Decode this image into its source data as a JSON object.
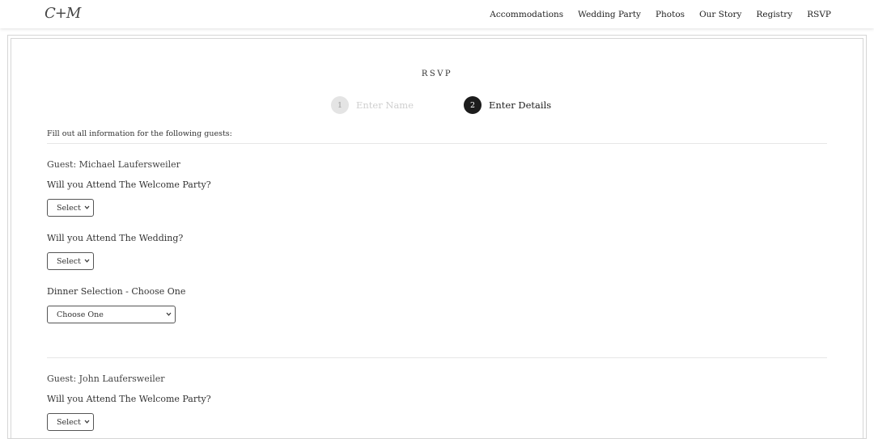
{
  "brand": {
    "logo": "C+M"
  },
  "nav": {
    "items": [
      {
        "label": "Accommodations"
      },
      {
        "label": "Wedding Party"
      },
      {
        "label": "Photos"
      },
      {
        "label": "Our Story"
      },
      {
        "label": "Registry"
      },
      {
        "label": "RSVP"
      }
    ]
  },
  "rsvp": {
    "title": "RSVP",
    "steps": [
      {
        "number": "1",
        "label": "Enter Name",
        "state": "inactive"
      },
      {
        "number": "2",
        "label": "Enter Details",
        "state": "active"
      }
    ],
    "intro": "Fill out all information for the following guests:"
  },
  "guests": [
    {
      "name": "Guest: Michael Laufersweiler",
      "welcome_question": "Will you Attend The Welcome Party?",
      "welcome_value": "Select",
      "wedding_question": "Will you Attend The Wedding?",
      "wedding_value": "Select",
      "dinner_question": "Dinner Selection - Choose One",
      "dinner_value": "Choose One"
    },
    {
      "name": "Guest: John Laufersweiler",
      "welcome_question": "Will you Attend The Welcome Party?",
      "welcome_value": "Select"
    }
  ],
  "colors": {
    "active_step": "#1c1c1c",
    "inactive_step": "#e4e4e4",
    "border": "#d6d6d6"
  }
}
